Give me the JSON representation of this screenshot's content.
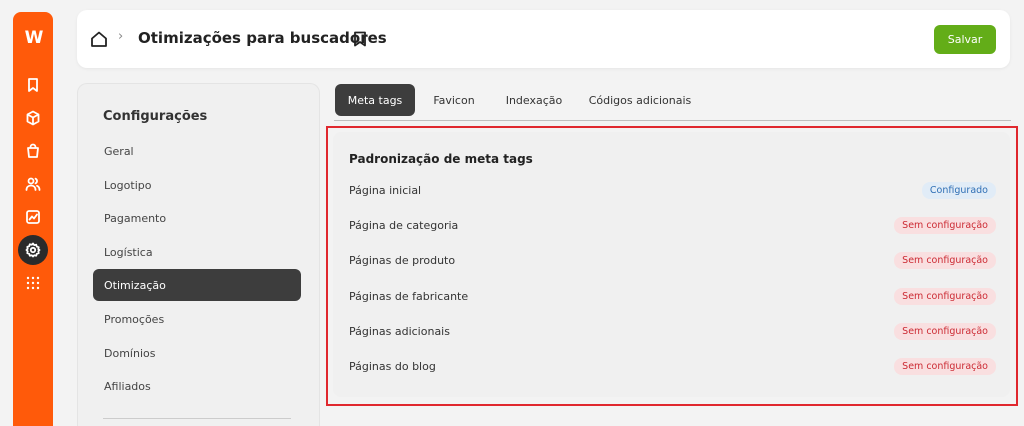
{
  "rail": {
    "logo": "W",
    "icons": [
      "bookmark-icon",
      "cube-icon",
      "shopping-bag-icon",
      "users-icon",
      "chart-icon",
      "settings-icon",
      "grid-icon"
    ],
    "accent": "#ff5a0a"
  },
  "header": {
    "title": "Otimizações para buscadores",
    "separator": "›",
    "save_label": "Salvar",
    "save_color": "#63ad18"
  },
  "sidebar": {
    "title": "Configurações",
    "items": [
      {
        "label": "Geral",
        "active": false
      },
      {
        "label": "Logotipo",
        "active": false
      },
      {
        "label": "Pagamento",
        "active": false
      },
      {
        "label": "Logística",
        "active": false
      },
      {
        "label": "Otimização",
        "active": true
      },
      {
        "label": "Promoções",
        "active": false
      },
      {
        "label": "Domínios",
        "active": false
      },
      {
        "label": "Afiliados",
        "active": false
      }
    ]
  },
  "tabs": [
    {
      "label": "Meta tags",
      "active": true
    },
    {
      "label": "Favicon",
      "active": false
    },
    {
      "label": "Indexação",
      "active": false
    },
    {
      "label": "Códigos adicionais",
      "active": false
    }
  ],
  "meta": {
    "title": "Padronização de meta tags",
    "rows": [
      {
        "label": "Página inicial",
        "status": "Configurado",
        "state": "ok"
      },
      {
        "label": "Página de categoria",
        "status": "Sem configuração",
        "state": "none"
      },
      {
        "label": "Páginas de produto",
        "status": "Sem configuração",
        "state": "none"
      },
      {
        "label": "Páginas de fabricante",
        "status": "Sem configuração",
        "state": "none"
      },
      {
        "label": "Páginas adicionais",
        "status": "Sem configuração",
        "state": "none"
      },
      {
        "label": "Páginas do blog",
        "status": "Sem configuração",
        "state": "none"
      }
    ]
  }
}
